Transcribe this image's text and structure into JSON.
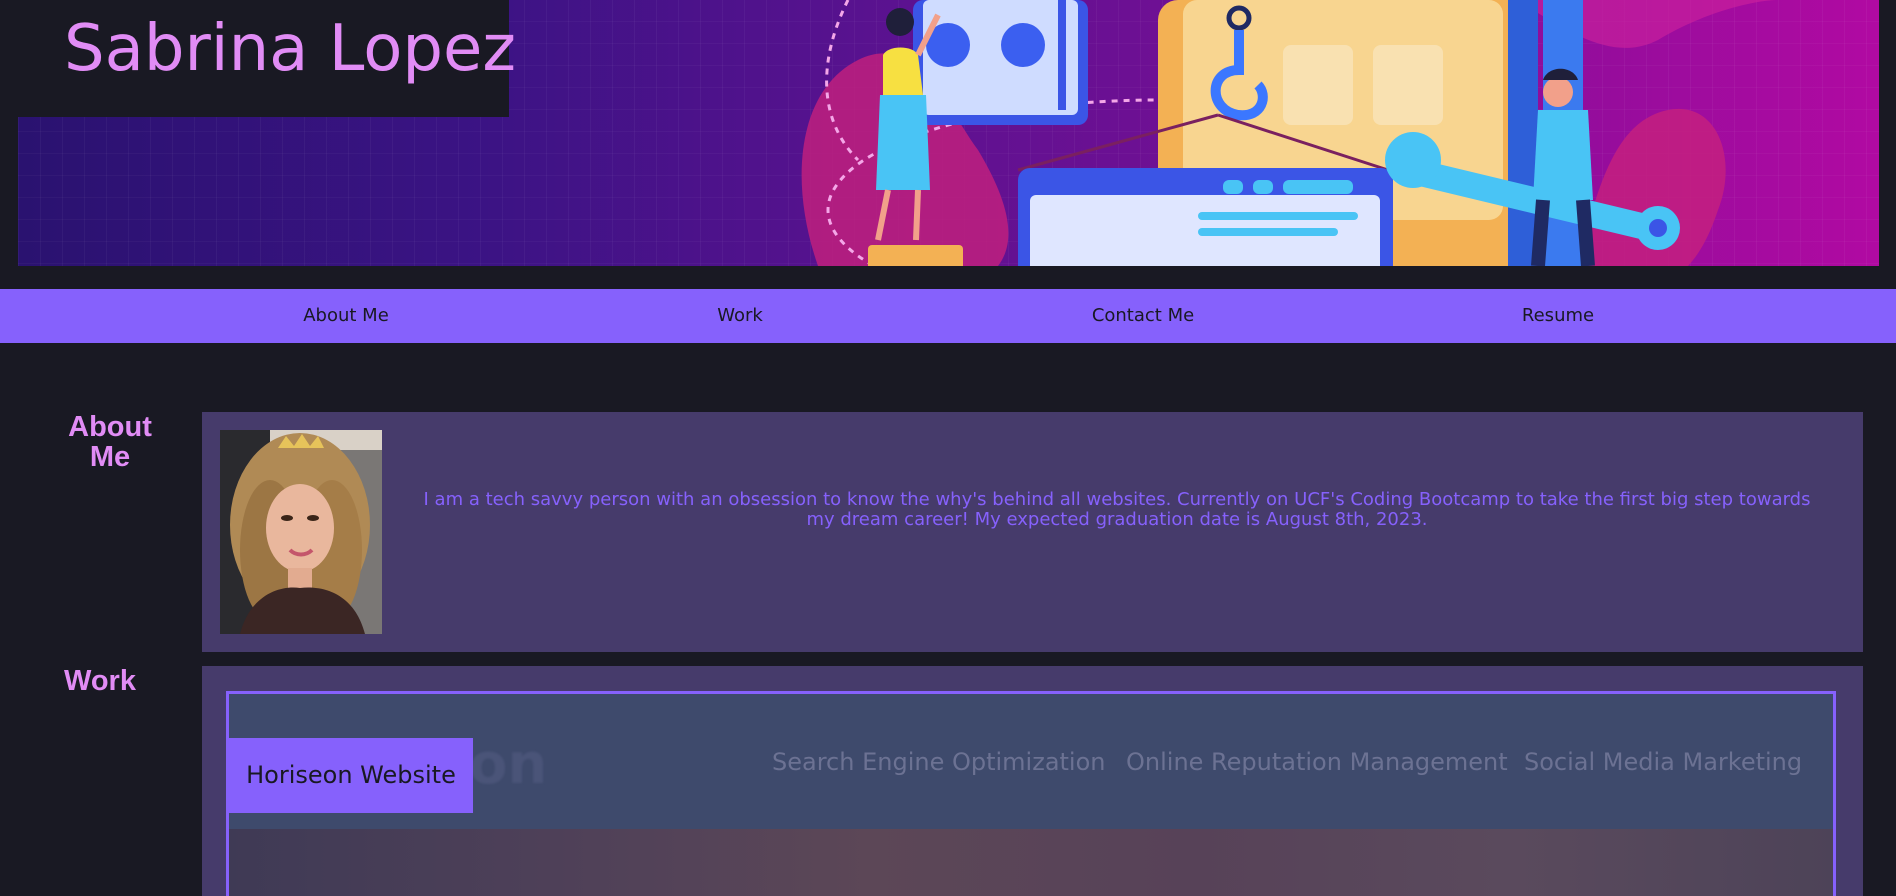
{
  "header": {
    "title": "Sabrina Lopez"
  },
  "nav": {
    "items": [
      {
        "label": "About Me"
      },
      {
        "label": "Work"
      },
      {
        "label": "Contact Me"
      },
      {
        "label": "Resume"
      }
    ]
  },
  "about": {
    "heading": "About Me",
    "text": "I am a tech savvy person with an obsession to know the why's behind all websites. Currently on UCF's Coding Bootcamp to take the first big step towards my dream career! My expected graduation date is August 8th, 2023."
  },
  "work": {
    "heading": "Work",
    "projects": [
      {
        "label": "Horiseon Website",
        "preview": {
          "logo": "on",
          "nav_items": [
            "Search Engine Optimization",
            "Online Reputation Management",
            "Social Media Marketing"
          ]
        }
      }
    ]
  },
  "colors": {
    "background": "#191923",
    "accent": "#8661fc",
    "heading": "#e18cf5",
    "card": "#463b6b"
  }
}
